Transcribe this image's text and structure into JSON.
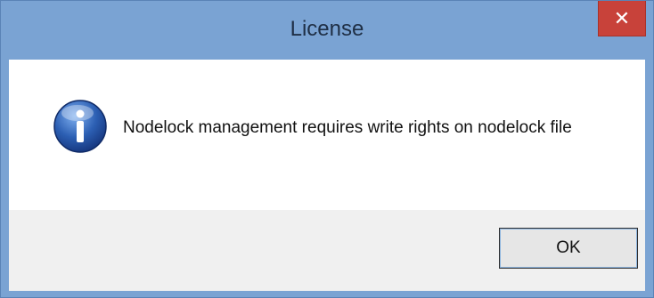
{
  "window": {
    "title": "License",
    "close_icon": "close-icon"
  },
  "message": {
    "icon": "information-icon",
    "text": "Nodelock management requires write rights on nodelock file"
  },
  "buttons": {
    "ok_label": "OK"
  },
  "colors": {
    "titlebar": "#7aa3d3",
    "close_button": "#c8423a",
    "footer": "#f0f0f0",
    "info_icon": "#2c5fb3"
  }
}
